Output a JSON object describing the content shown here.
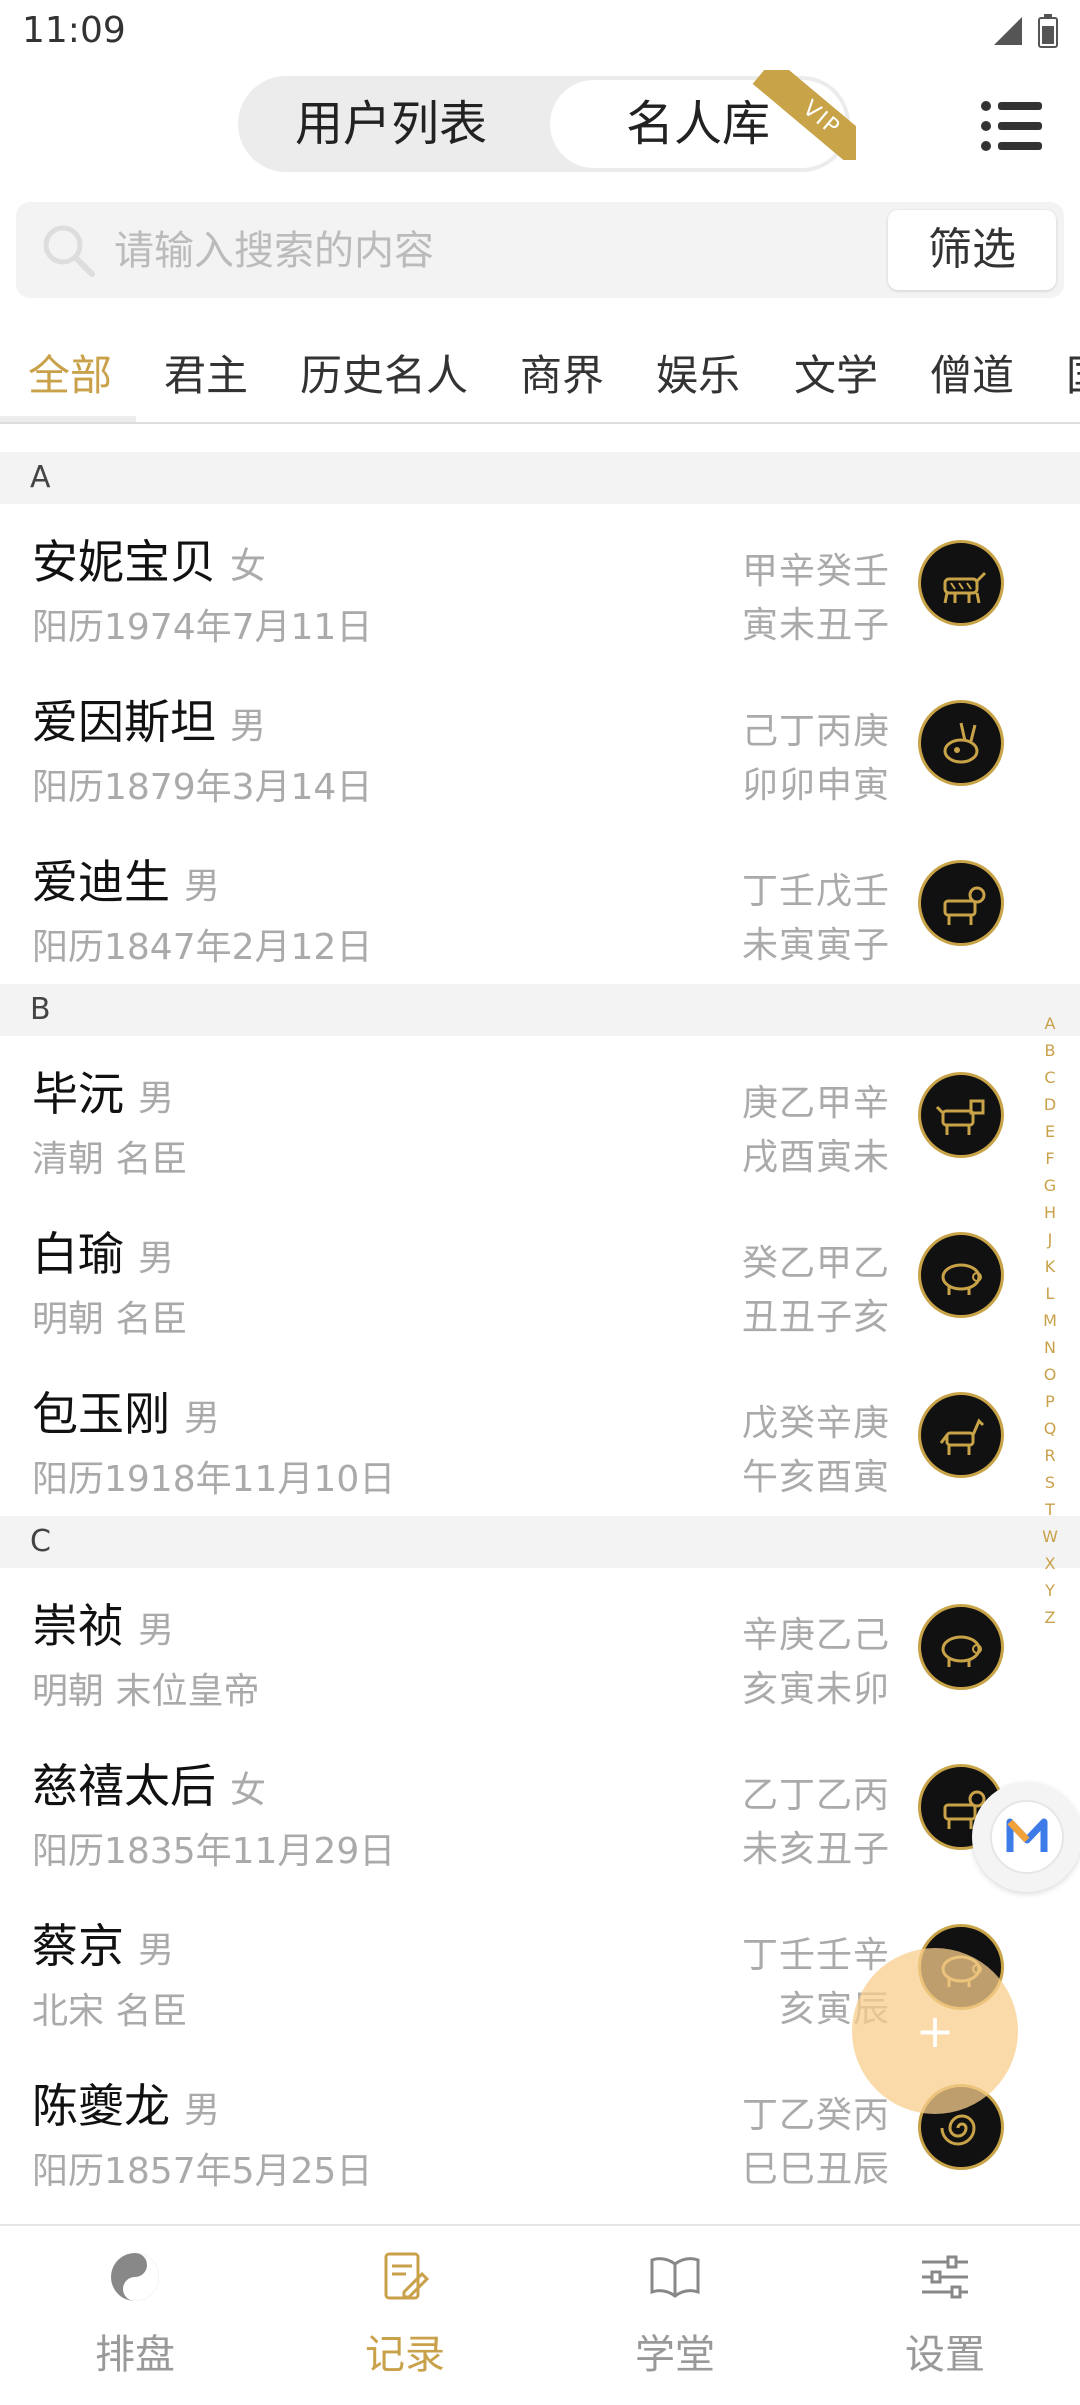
{
  "status_bar": {
    "time": "11:09"
  },
  "header": {
    "tabs": [
      {
        "label": "用户列表"
      },
      {
        "label": "名人库"
      }
    ],
    "active_tab": 1,
    "vip_badge": "VIP",
    "menu_icon": "menu-icon"
  },
  "search": {
    "placeholder": "请输入搜索的内容",
    "filter_label": "筛选"
  },
  "categories": {
    "items": [
      "全部",
      "君主",
      "历史名人",
      "商界",
      "娱乐",
      "文学",
      "僧道",
      "国"
    ],
    "active": 0
  },
  "sections": [
    {
      "letter": "A",
      "items": [
        {
          "name": "安妮宝贝",
          "gender": "女",
          "sub": "阳历1974年7月11日",
          "bazi_top": "甲辛癸壬",
          "bazi_bottom": "寅未丑子",
          "zodiac_icon": "tiger-zodiac-icon"
        },
        {
          "name": "爱因斯坦",
          "gender": "男",
          "sub": "阳历1879年3月14日",
          "bazi_top": "己丁丙庚",
          "bazi_bottom": "卯卯申寅",
          "zodiac_icon": "rabbit-zodiac-icon"
        },
        {
          "name": "爱迪生",
          "gender": "男",
          "sub": "阳历1847年2月12日",
          "bazi_top": "丁壬戊壬",
          "bazi_bottom": "未寅寅子",
          "zodiac_icon": "goat-zodiac-icon"
        }
      ]
    },
    {
      "letter": "B",
      "items": [
        {
          "name": "毕沅",
          "gender": "男",
          "sub": "清朝 名臣",
          "bazi_top": "庚乙甲辛",
          "bazi_bottom": "戌酉寅未",
          "zodiac_icon": "dog-zodiac-icon"
        },
        {
          "name": "白瑜",
          "gender": "男",
          "sub": "明朝 名臣",
          "bazi_top": "癸乙甲乙",
          "bazi_bottom": "丑丑子亥",
          "zodiac_icon": "pig-zodiac-icon"
        },
        {
          "name": "包玉刚",
          "gender": "男",
          "sub": "阳历1918年11月10日",
          "bazi_top": "戊癸辛庚",
          "bazi_bottom": "午亥酉寅",
          "zodiac_icon": "horse-zodiac-icon"
        }
      ]
    },
    {
      "letter": "C",
      "items": [
        {
          "name": "崇祯",
          "gender": "男",
          "sub": "明朝 末位皇帝",
          "bazi_top": "辛庚乙己",
          "bazi_bottom": "亥寅未卯",
          "zodiac_icon": "pig-zodiac-icon"
        },
        {
          "name": "慈禧太后",
          "gender": "女",
          "sub": "阳历1835年11月29日",
          "bazi_top": "乙丁乙丙",
          "bazi_bottom": "未亥丑子",
          "zodiac_icon": "goat-zodiac-icon"
        },
        {
          "name": "蔡京",
          "gender": "男",
          "sub": "北宋 名臣",
          "bazi_top": "丁壬壬辛",
          "bazi_bottom": "亥寅辰",
          "zodiac_icon": "pig-zodiac-icon"
        },
        {
          "name": "陈夔龙",
          "gender": "男",
          "sub": "阳历1857年5月25日",
          "bazi_top": "丁乙癸丙",
          "bazi_bottom": "巳巳丑辰",
          "zodiac_icon": "snake-zodiac-icon"
        }
      ]
    }
  ],
  "alphabet_index": [
    "A",
    "B",
    "C",
    "D",
    "E",
    "F",
    "G",
    "H",
    "J",
    "K",
    "L",
    "M",
    "N",
    "O",
    "P",
    "Q",
    "R",
    "S",
    "T",
    "W",
    "X",
    "Y",
    "Z"
  ],
  "fab": {
    "label": "+"
  },
  "bottom_nav": {
    "items": [
      {
        "label": "排盘",
        "icon": "yin-yang-icon"
      },
      {
        "label": "记录",
        "icon": "note-edit-icon"
      },
      {
        "label": "学堂",
        "icon": "book-icon"
      },
      {
        "label": "设置",
        "icon": "sliders-icon"
      }
    ],
    "active": 1
  },
  "colors": {
    "accent": "#c9a14a",
    "secondary_text": "#aaaaaa",
    "section_bg": "#f3f3f3"
  }
}
